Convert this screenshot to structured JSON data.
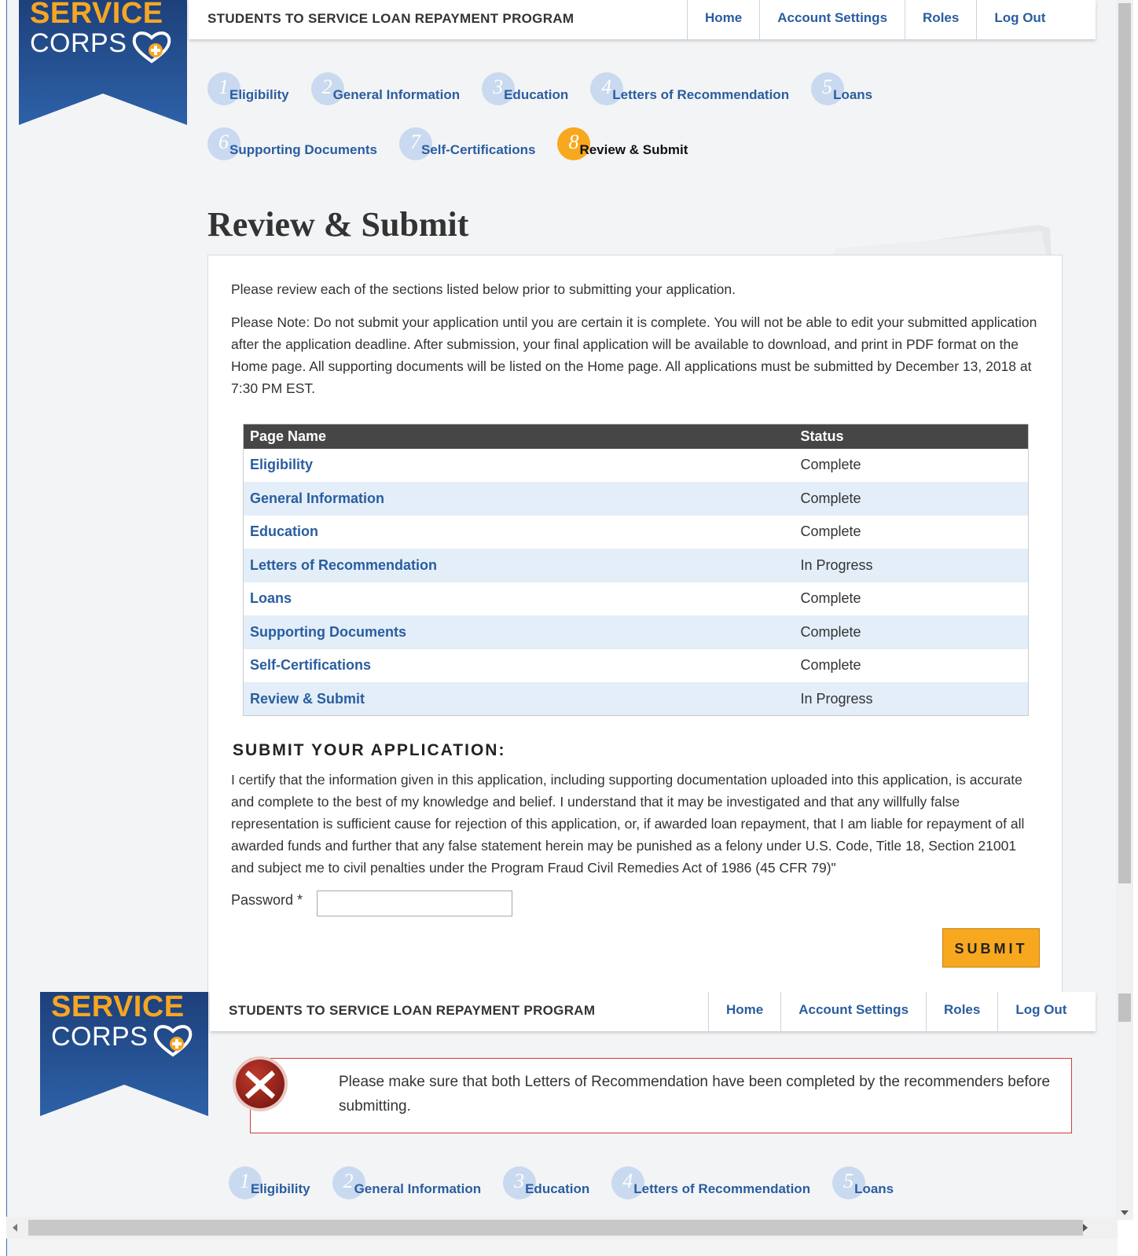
{
  "logo": {
    "line1": "SERVICE",
    "line2": "CORPS"
  },
  "header": {
    "program": "STUDENTS TO SERVICE LOAN REPAYMENT PROGRAM",
    "nav": [
      "Home",
      "Account Settings",
      "Roles",
      "Log Out"
    ]
  },
  "steps": [
    {
      "num": "1",
      "label": "Eligibility"
    },
    {
      "num": "2",
      "label": "General Information"
    },
    {
      "num": "3",
      "label": "Education"
    },
    {
      "num": "4",
      "label": "Letters of Recommendation"
    },
    {
      "num": "5",
      "label": "Loans"
    },
    {
      "num": "6",
      "label": "Supporting Documents"
    },
    {
      "num": "7",
      "label": "Self-Certifications"
    },
    {
      "num": "8",
      "label": "Review & Submit"
    }
  ],
  "active_step": "8",
  "main": {
    "title": "Review & Submit",
    "intro": "Please review each of the sections listed below prior to submitting your application.",
    "note": "Please Note: Do not submit your application until you are certain it is complete. You will not be able to edit your submitted application after the application deadline. After submission, your final application will be available to download, and print in PDF format on the Home page. All supporting documents will be listed on the Home page. All applications must be submitted by December 13, 2018 at 7:30 PM EST.",
    "table": {
      "headers": [
        "Page Name",
        "Status"
      ],
      "rows": [
        {
          "page": "Eligibility",
          "status": "Complete"
        },
        {
          "page": "General Information",
          "status": "Complete"
        },
        {
          "page": "Education",
          "status": "Complete"
        },
        {
          "page": "Letters of Recommendation",
          "status": "In Progress"
        },
        {
          "page": "Loans",
          "status": "Complete"
        },
        {
          "page": "Supporting Documents",
          "status": "Complete"
        },
        {
          "page": "Self-Certifications",
          "status": "Complete"
        },
        {
          "page": "Review & Submit",
          "status": "In Progress"
        }
      ]
    },
    "submit_heading": "SUBMIT YOUR APPLICATION:",
    "certify": "I certify that the information given in this application, including supporting documentation uploaded into this application, is accurate and complete to the best of my knowledge and belief. I understand that it may be investigated and that any willfully false representation is sufficient cause for rejection of this application, or, if awarded loan repayment, that I am liable for repayment of all awarded funds and further that any false statement herein may be punished as a felony under U.S. Code, Title 18, Section 21001 and subject me to civil penalties under the Program Fraud Civil Remedies Act of 1986 (45 CFR 79)\"",
    "password_label": "Password *",
    "password_value": "",
    "submit_label": "SUBMIT"
  },
  "error": {
    "message": "Please make sure that both Letters of Recommendation have been completed by the recommenders before submitting."
  },
  "colors": {
    "brand_orange": "#f7a81e",
    "link_blue": "#2a5d9f",
    "step_circle": "#c9d9ef",
    "table_header": "#464646",
    "row_alt": "#e3eef9",
    "error_red": "#d33a3a"
  },
  "icons": {
    "heart": "heart-plus-icon",
    "error": "error-x-icon"
  }
}
